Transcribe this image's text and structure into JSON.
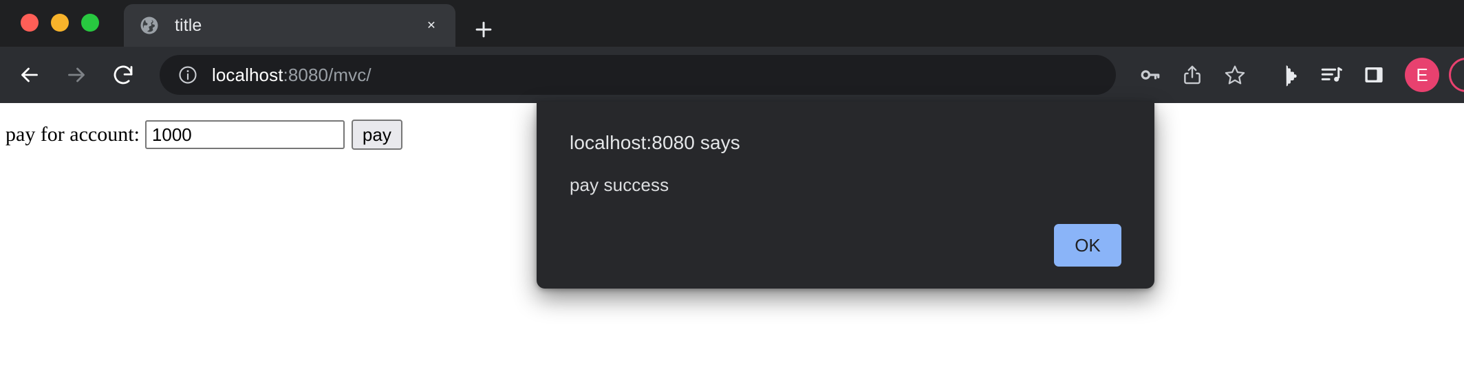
{
  "window": {
    "traffic_lights": [
      {
        "name": "close",
        "color": "#ff5f57"
      },
      {
        "name": "minimize",
        "color": "#f7b32b"
      },
      {
        "name": "maximize",
        "color": "#28c840"
      }
    ]
  },
  "tabstrip": {
    "tabs": [
      {
        "title": "title",
        "favicon": "globe-icon",
        "close_label": "✕",
        "active": true
      }
    ],
    "new_tab_label": "+"
  },
  "toolbar": {
    "back_icon": "arrow-left-icon",
    "forward_icon": "arrow-right-icon",
    "reload_icon": "reload-icon",
    "omnibox": {
      "info_icon": "info-circle-icon",
      "url_host": "localhost",
      "url_rest": ":8080/mvc/",
      "full_url": "localhost:8080/mvc/"
    },
    "actions": [
      {
        "name": "password-key-icon"
      },
      {
        "name": "share-icon"
      },
      {
        "name": "bookmark-star-icon"
      },
      {
        "name": "extensions-puzzle-icon"
      },
      {
        "name": "media-control-icon"
      },
      {
        "name": "side-panel-icon"
      }
    ],
    "profile": {
      "initial": "E",
      "color": "#e8416f"
    }
  },
  "page": {
    "form": {
      "label": "pay for account:",
      "amount_value": "1000",
      "amount_placeholder": "",
      "submit_label": "pay"
    }
  },
  "dialog": {
    "origin_title": "localhost:8080 says",
    "message": "pay success",
    "ok_label": "OK",
    "ok_color": "#8ab4f8",
    "background": "#27282b"
  }
}
